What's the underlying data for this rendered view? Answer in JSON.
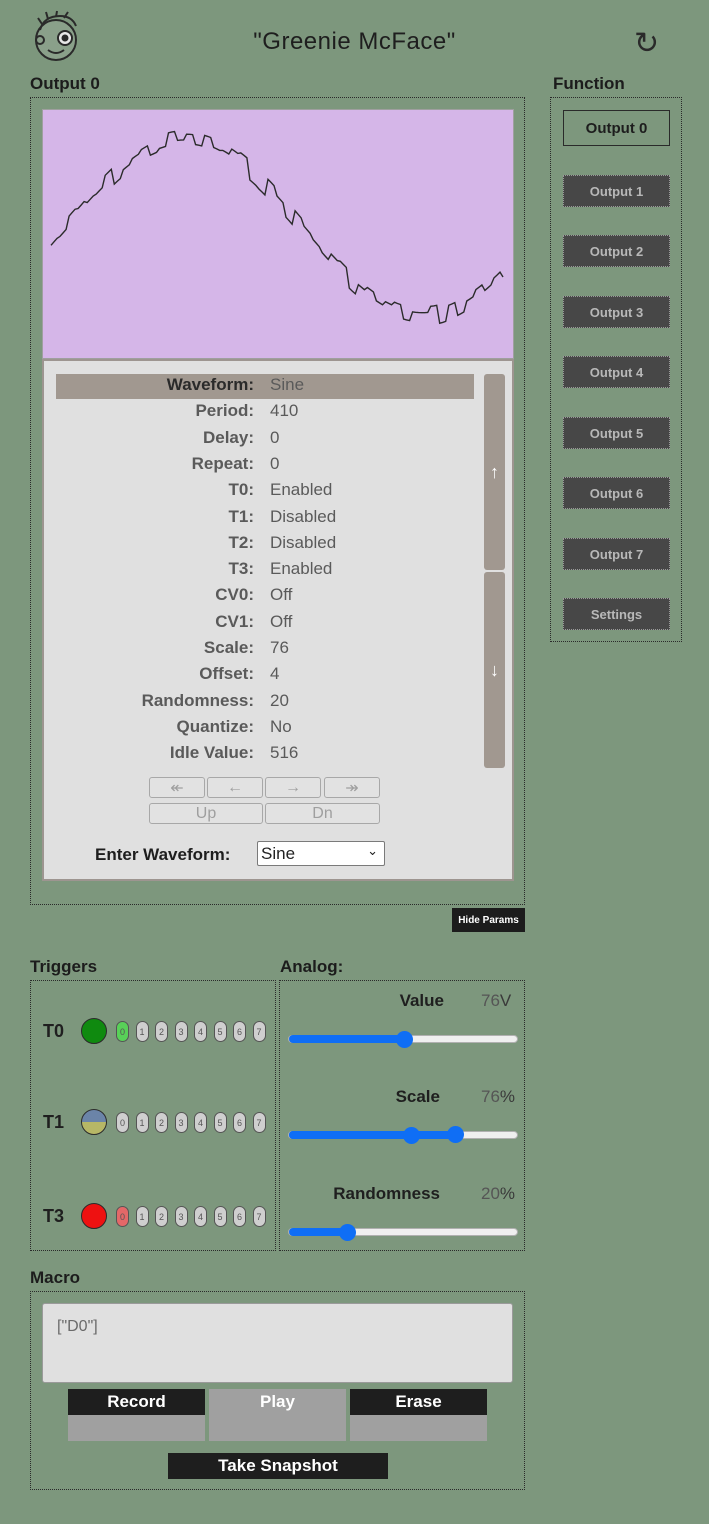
{
  "header": {
    "title": "\"Greenie McFace\"",
    "refresh_icon": "↻"
  },
  "output": {
    "title": "Output 0",
    "params": [
      {
        "label": "Waveform:",
        "value": "Sine"
      },
      {
        "label": "Period:",
        "value": "410"
      },
      {
        "label": "Delay:",
        "value": "0"
      },
      {
        "label": "Repeat:",
        "value": "0"
      },
      {
        "label": "T0:",
        "value": "Enabled"
      },
      {
        "label": "T1:",
        "value": "Disabled"
      },
      {
        "label": "T2:",
        "value": "Disabled"
      },
      {
        "label": "T3:",
        "value": "Enabled"
      },
      {
        "label": "CV0:",
        "value": "Off"
      },
      {
        "label": "CV1:",
        "value": "Off"
      },
      {
        "label": "Scale:",
        "value": "76"
      },
      {
        "label": "Offset:",
        "value": "4"
      },
      {
        "label": "Randomness:",
        "value": "20"
      },
      {
        "label": "Quantize:",
        "value": "No"
      },
      {
        "label": "Idle Value:",
        "value": "516"
      }
    ],
    "scroll_up": "↑",
    "scroll_down": "↓",
    "nav": {
      "first": "↞",
      "prev": "←",
      "next": "→",
      "last": "↠",
      "up": "Up",
      "dn": "Dn"
    },
    "enter_label": "Enter Waveform:",
    "waveform_selected": "Sine",
    "hide_params": "Hide Params"
  },
  "function": {
    "title": "Function",
    "active": "Output 0",
    "items": [
      "Output 1",
      "Output 2",
      "Output 3",
      "Output 4",
      "Output 5",
      "Output 6",
      "Output 7",
      "Settings"
    ]
  },
  "triggers": {
    "title": "Triggers",
    "rows": [
      {
        "label": "T0",
        "led": "green",
        "active_pill": 0
      },
      {
        "label": "T1",
        "led": "half",
        "active_pill": null
      },
      {
        "label": "T3",
        "led": "red",
        "active_pill": 0
      }
    ],
    "pills": [
      "0",
      "1",
      "2",
      "3",
      "4",
      "5",
      "6",
      "7"
    ]
  },
  "analog": {
    "title": "Analog:",
    "controls": [
      {
        "label": "Value",
        "value": "76",
        "unit": "V",
        "level": 0.5
      },
      {
        "label": "Scale",
        "value": "76",
        "unit": "%",
        "level": 0.53,
        "level2": 0.72
      },
      {
        "label": "Randomness",
        "value": "20",
        "unit": "%",
        "level": 0.25
      }
    ]
  },
  "macro": {
    "title": "Macro",
    "text": "[\"D0\"]",
    "record": "Record",
    "play": "Play",
    "erase": "Erase",
    "snapshot": "Take Snapshot"
  },
  "colors": {
    "background": "#7d977d",
    "wave_bg": "#d5b6e8",
    "accent": "#0f6ef5",
    "led_green": "#0f8a0f",
    "led_red": "#ee1111"
  }
}
